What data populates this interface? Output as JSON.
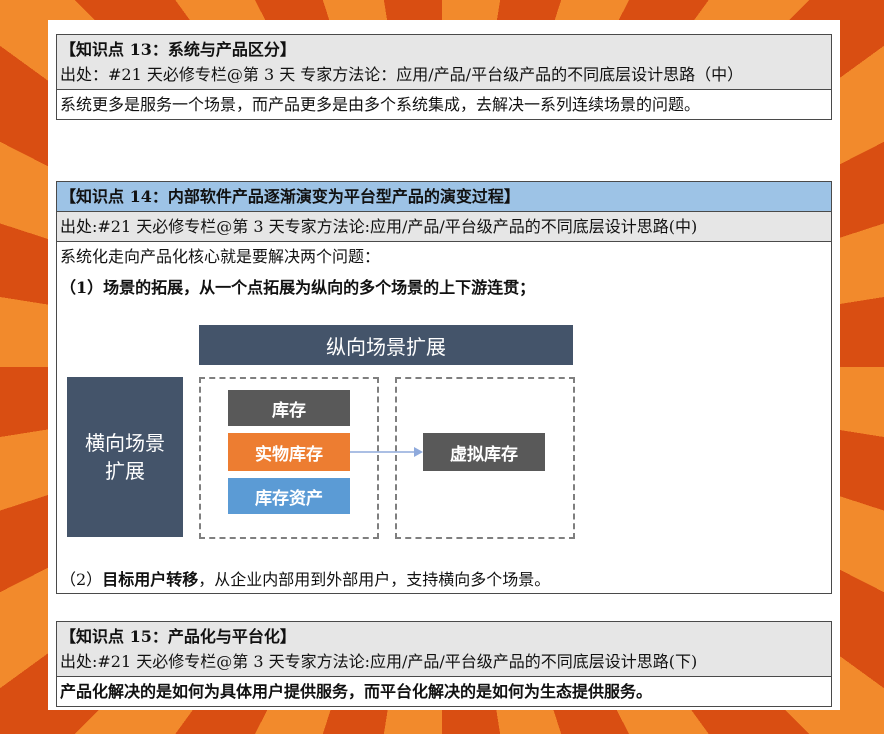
{
  "card13": {
    "title": "【知识点 13：系统与产品区分】",
    "source": "出处：#21 天必修专栏@第 3 天  专家方法论：应用/产品/平台级产品的不同底层设计思路（中）",
    "body": "系统更多是服务一个场景，而产品更多是由多个系统集成，去解决一系列连续场景的问题。"
  },
  "card14": {
    "title": "【知识点 14：内部软件产品逐渐演变为平台型产品的演变过程】",
    "source": "出处:#21 天必修专栏@第 3 天专家方法论:应用/产品/平台级产品的不同底层设计思路(中)",
    "intro": "系统化走向产品化核心就是要解决两个问题：",
    "point1": "（1）场景的拓展，从一个点拓展为纵向的多个场景的上下游连贯；",
    "point2_prefix": "（2）",
    "point2_bold": "目标用户转移",
    "point2_rest": "，从企业内部用到外部用户，支持横向多个场景。",
    "diagram": {
      "vertical_label": "纵向场景扩展",
      "horizontal_label_1": "横向场景",
      "horizontal_label_2": "扩展",
      "box_inventory": "库存",
      "box_physical": "实物库存",
      "box_assets": "库存资产",
      "box_virtual": "虚拟库存"
    }
  },
  "card15": {
    "title": "【知识点 15：产品化与平台化】",
    "source": "出处:#21 天必修专栏@第 3 天专家方法论:应用/产品/平台级产品的不同底层设计思路(下)",
    "body": "产品化解决的是如何为具体用户提供服务，而平台化解决的是如何为生态提供服务。"
  },
  "colors": {
    "header_grey": "#e6e6e6",
    "header_blue": "#9dc3e6",
    "slate": "#44546a",
    "dark_grey": "#595959",
    "orange": "#ed7d31",
    "blue": "#5b9bd5"
  }
}
